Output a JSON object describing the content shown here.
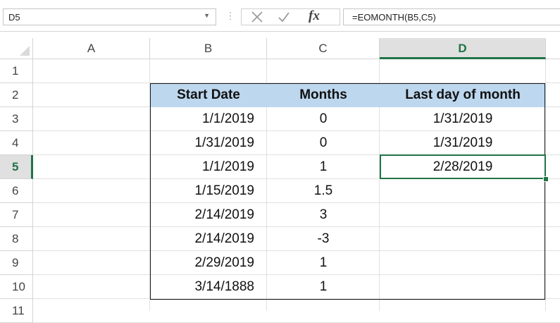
{
  "formula_bar": {
    "name_box": "D5",
    "formula": "=EOMONTH(B5,C5)",
    "fx_label": "fx",
    "separator": "⋮"
  },
  "columns": [
    "A",
    "B",
    "C",
    "D"
  ],
  "selected_column": "D",
  "rows": [
    "1",
    "2",
    "3",
    "4",
    "5",
    "6",
    "7",
    "8",
    "9",
    "10",
    "11"
  ],
  "selected_row": "5",
  "table": {
    "headers": [
      "Start Date",
      "Months",
      "Last day of month"
    ],
    "rows": [
      {
        "start": "1/1/2019",
        "months": "0",
        "last": "1/31/2019"
      },
      {
        "start": "1/31/2019",
        "months": "0",
        "last": "1/31/2019"
      },
      {
        "start": "1/1/2019",
        "months": "1",
        "last": "2/28/2019"
      },
      {
        "start": "1/15/2019",
        "months": "1.5",
        "last": ""
      },
      {
        "start": "2/14/2019",
        "months": "3",
        "last": ""
      },
      {
        "start": "2/14/2019",
        "months": "-3",
        "last": ""
      },
      {
        "start": "2/29/2019",
        "months": "1",
        "last": ""
      },
      {
        "start": "3/14/1888",
        "months": "1",
        "last": ""
      }
    ]
  },
  "colors": {
    "header_fill": "#bdd7ee",
    "selection": "#217346"
  }
}
